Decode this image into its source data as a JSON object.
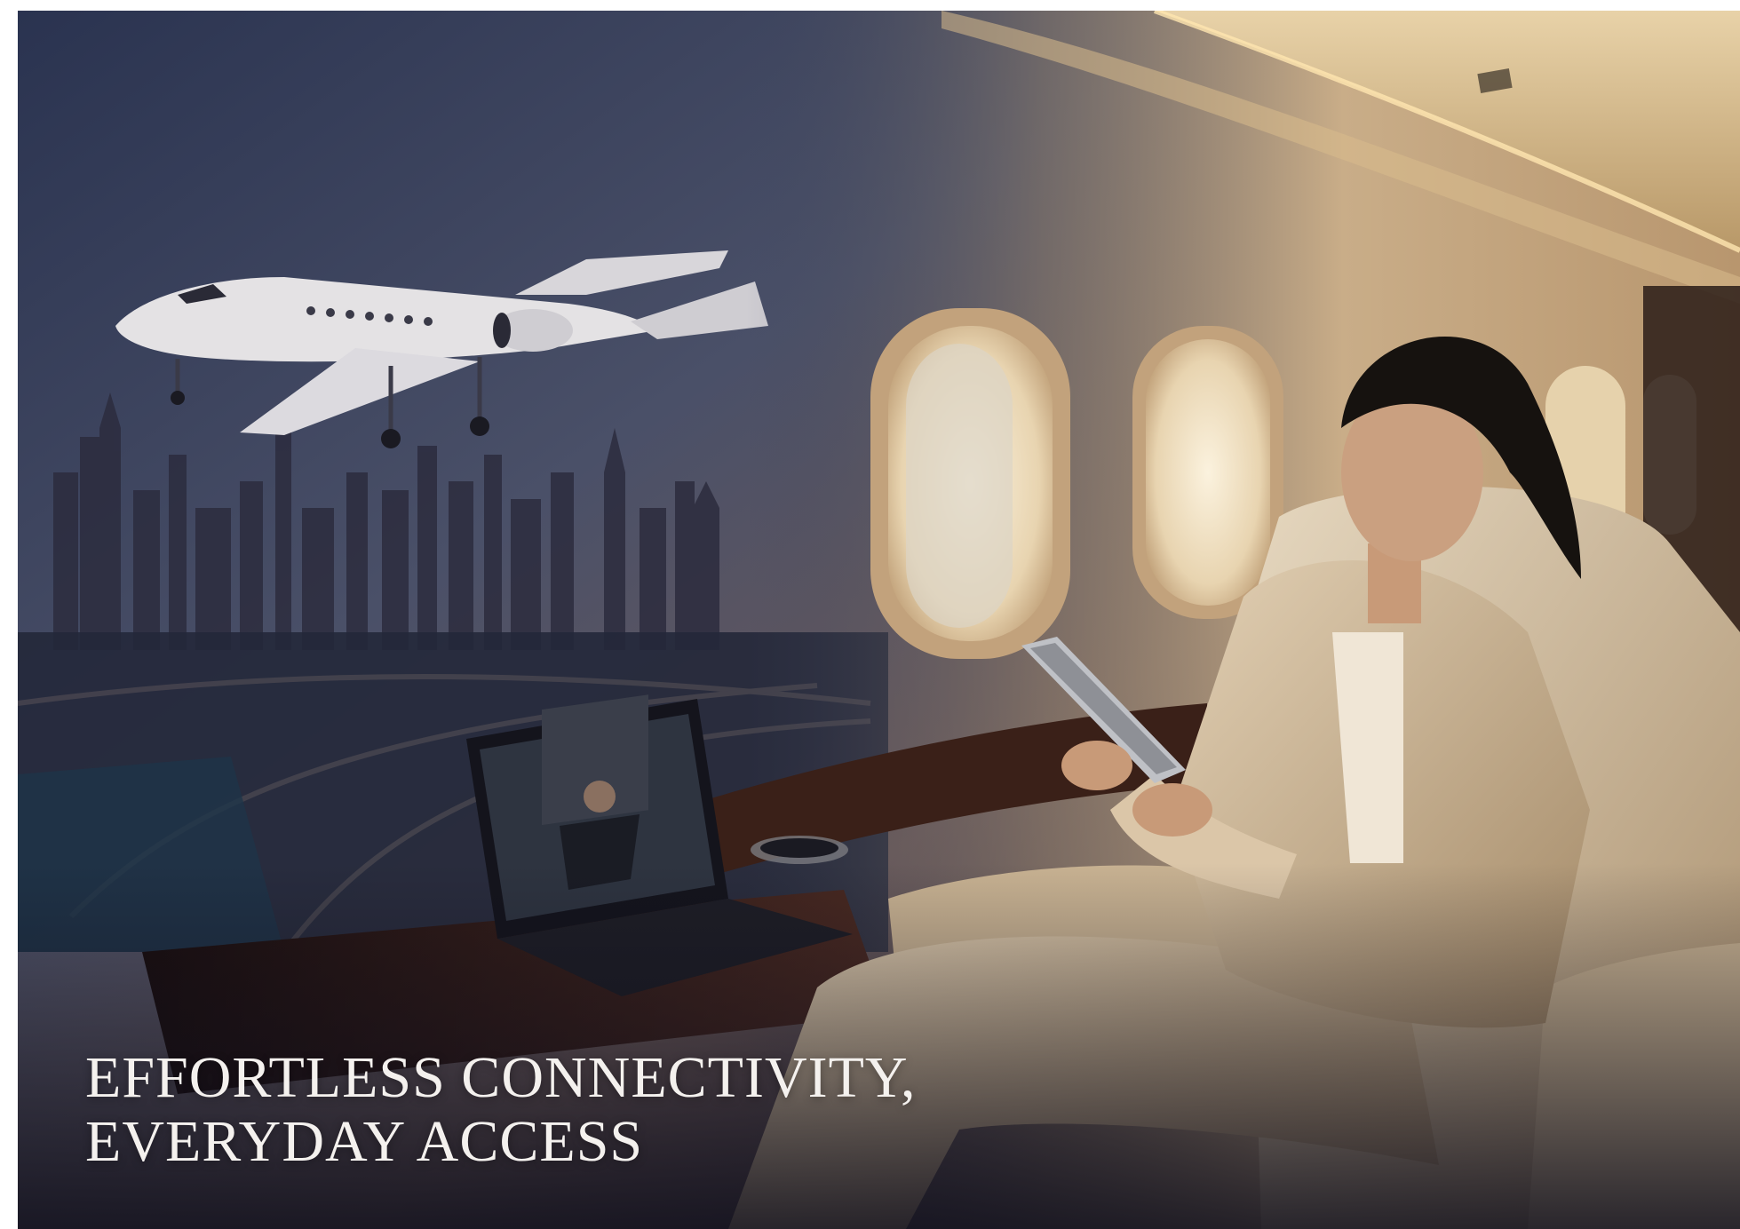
{
  "headline": {
    "line1": "EFFORTLESS CONNECTIVITY,",
    "line2": "EVERYDAY ACCESS"
  },
  "colors": {
    "dusk_sky": "#3a4460",
    "cabin_warm": "#c9a77e",
    "seat_beige": "#d8c7ad",
    "headline_text": "#f4f1ee"
  }
}
